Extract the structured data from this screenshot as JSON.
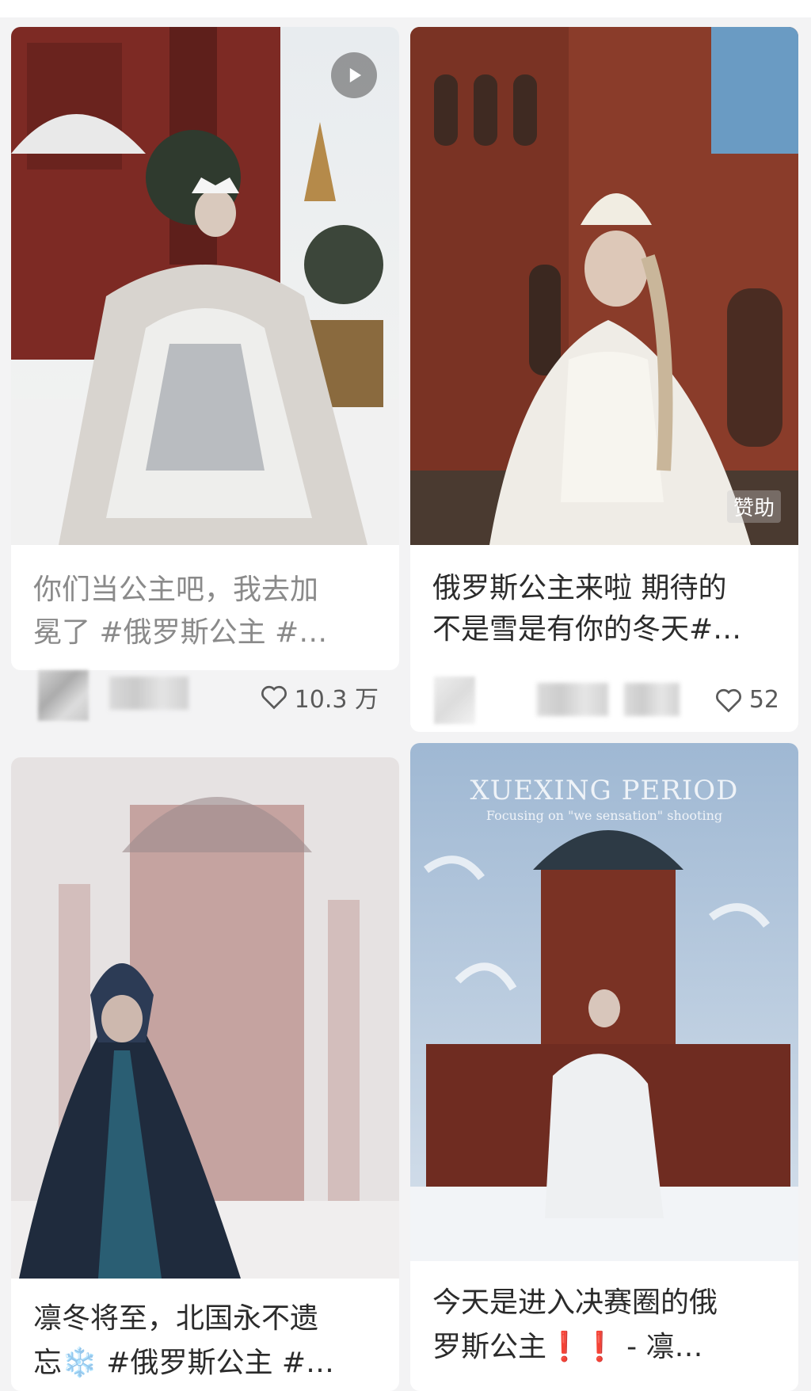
{
  "feed": {
    "cards": [
      {
        "title_line1": "你们当公主吧，我去加",
        "title_line2": "冕了 #俄罗斯公主 #…",
        "likes": "10.3 万",
        "has_play": true,
        "icons": [
          "play-icon",
          "heart-icon"
        ]
      },
      {
        "title_line1": "俄罗斯公主来啦 期待的",
        "title_line2": "不是雪是有你的冬天#…",
        "likes": "52",
        "badge": "赞助",
        "icons": [
          "heart-icon"
        ]
      },
      {
        "title_line1": "凛冬将至，北国永不遗",
        "title_line2_prefix": "忘",
        "title_line2_emoji": "❄️",
        "title_line2_suffix": " #俄罗斯公主 #…"
      },
      {
        "watermark_title": "XUEXING PERIOD",
        "watermark_subtitle": "Focusing on \"we sensation\" shooting",
        "title_line1": "今天是进入决赛圈的俄",
        "title_line2_prefix": "罗斯公主",
        "title_line2_marks": "❗❗",
        "title_line2_suffix": " - 凛…"
      }
    ]
  },
  "colors": {
    "background": "#f3f3f4",
    "card": "#ffffff",
    "text": "#2b2b2b",
    "muted_text": "#8a8a8a"
  }
}
